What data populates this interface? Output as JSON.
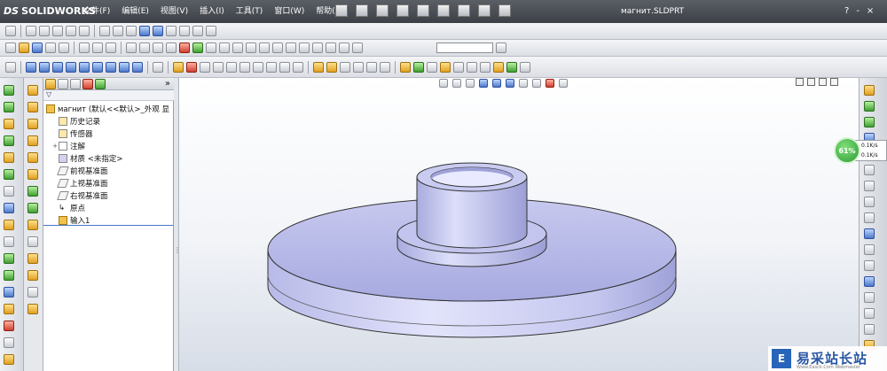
{
  "app": {
    "brand": "SOLIDWORKS",
    "document_title": "магнит.SLDPRT"
  },
  "menu": {
    "items": [
      "文件(F)",
      "编辑(E)",
      "视图(V)",
      "插入(I)",
      "工具(T)",
      "窗口(W)",
      "帮助(H)"
    ]
  },
  "help": {
    "question": "?",
    "min": "-",
    "close": "×"
  },
  "feature_tree": {
    "root": "магнит (默认<<默认>_外观 显",
    "items": [
      {
        "label": "历史记录",
        "expand": ""
      },
      {
        "label": "传感器",
        "expand": ""
      },
      {
        "label": "注解",
        "expand": "+"
      },
      {
        "label": "材质 <未指定>",
        "expand": ""
      },
      {
        "label": "前视基准面",
        "expand": ""
      },
      {
        "label": "上视基准面",
        "expand": ""
      },
      {
        "label": "右视基准面",
        "expand": ""
      },
      {
        "label": "原点",
        "expand": ""
      },
      {
        "label": "输入1",
        "expand": ""
      }
    ],
    "collapse": "»"
  },
  "network_widget": {
    "percent": "61%",
    "up": "0.1K/s",
    "down": "0.1K/s"
  },
  "watermark": {
    "icon_letter": "E",
    "text": "易采站长站",
    "subtext": "Www.Easck.Com Webmaster"
  },
  "colors": {
    "titlebar": "#3c4046",
    "model": "#c9cbf0",
    "model_dark": "#8c8fcf",
    "viewport_bottom": "#d7dde7"
  }
}
